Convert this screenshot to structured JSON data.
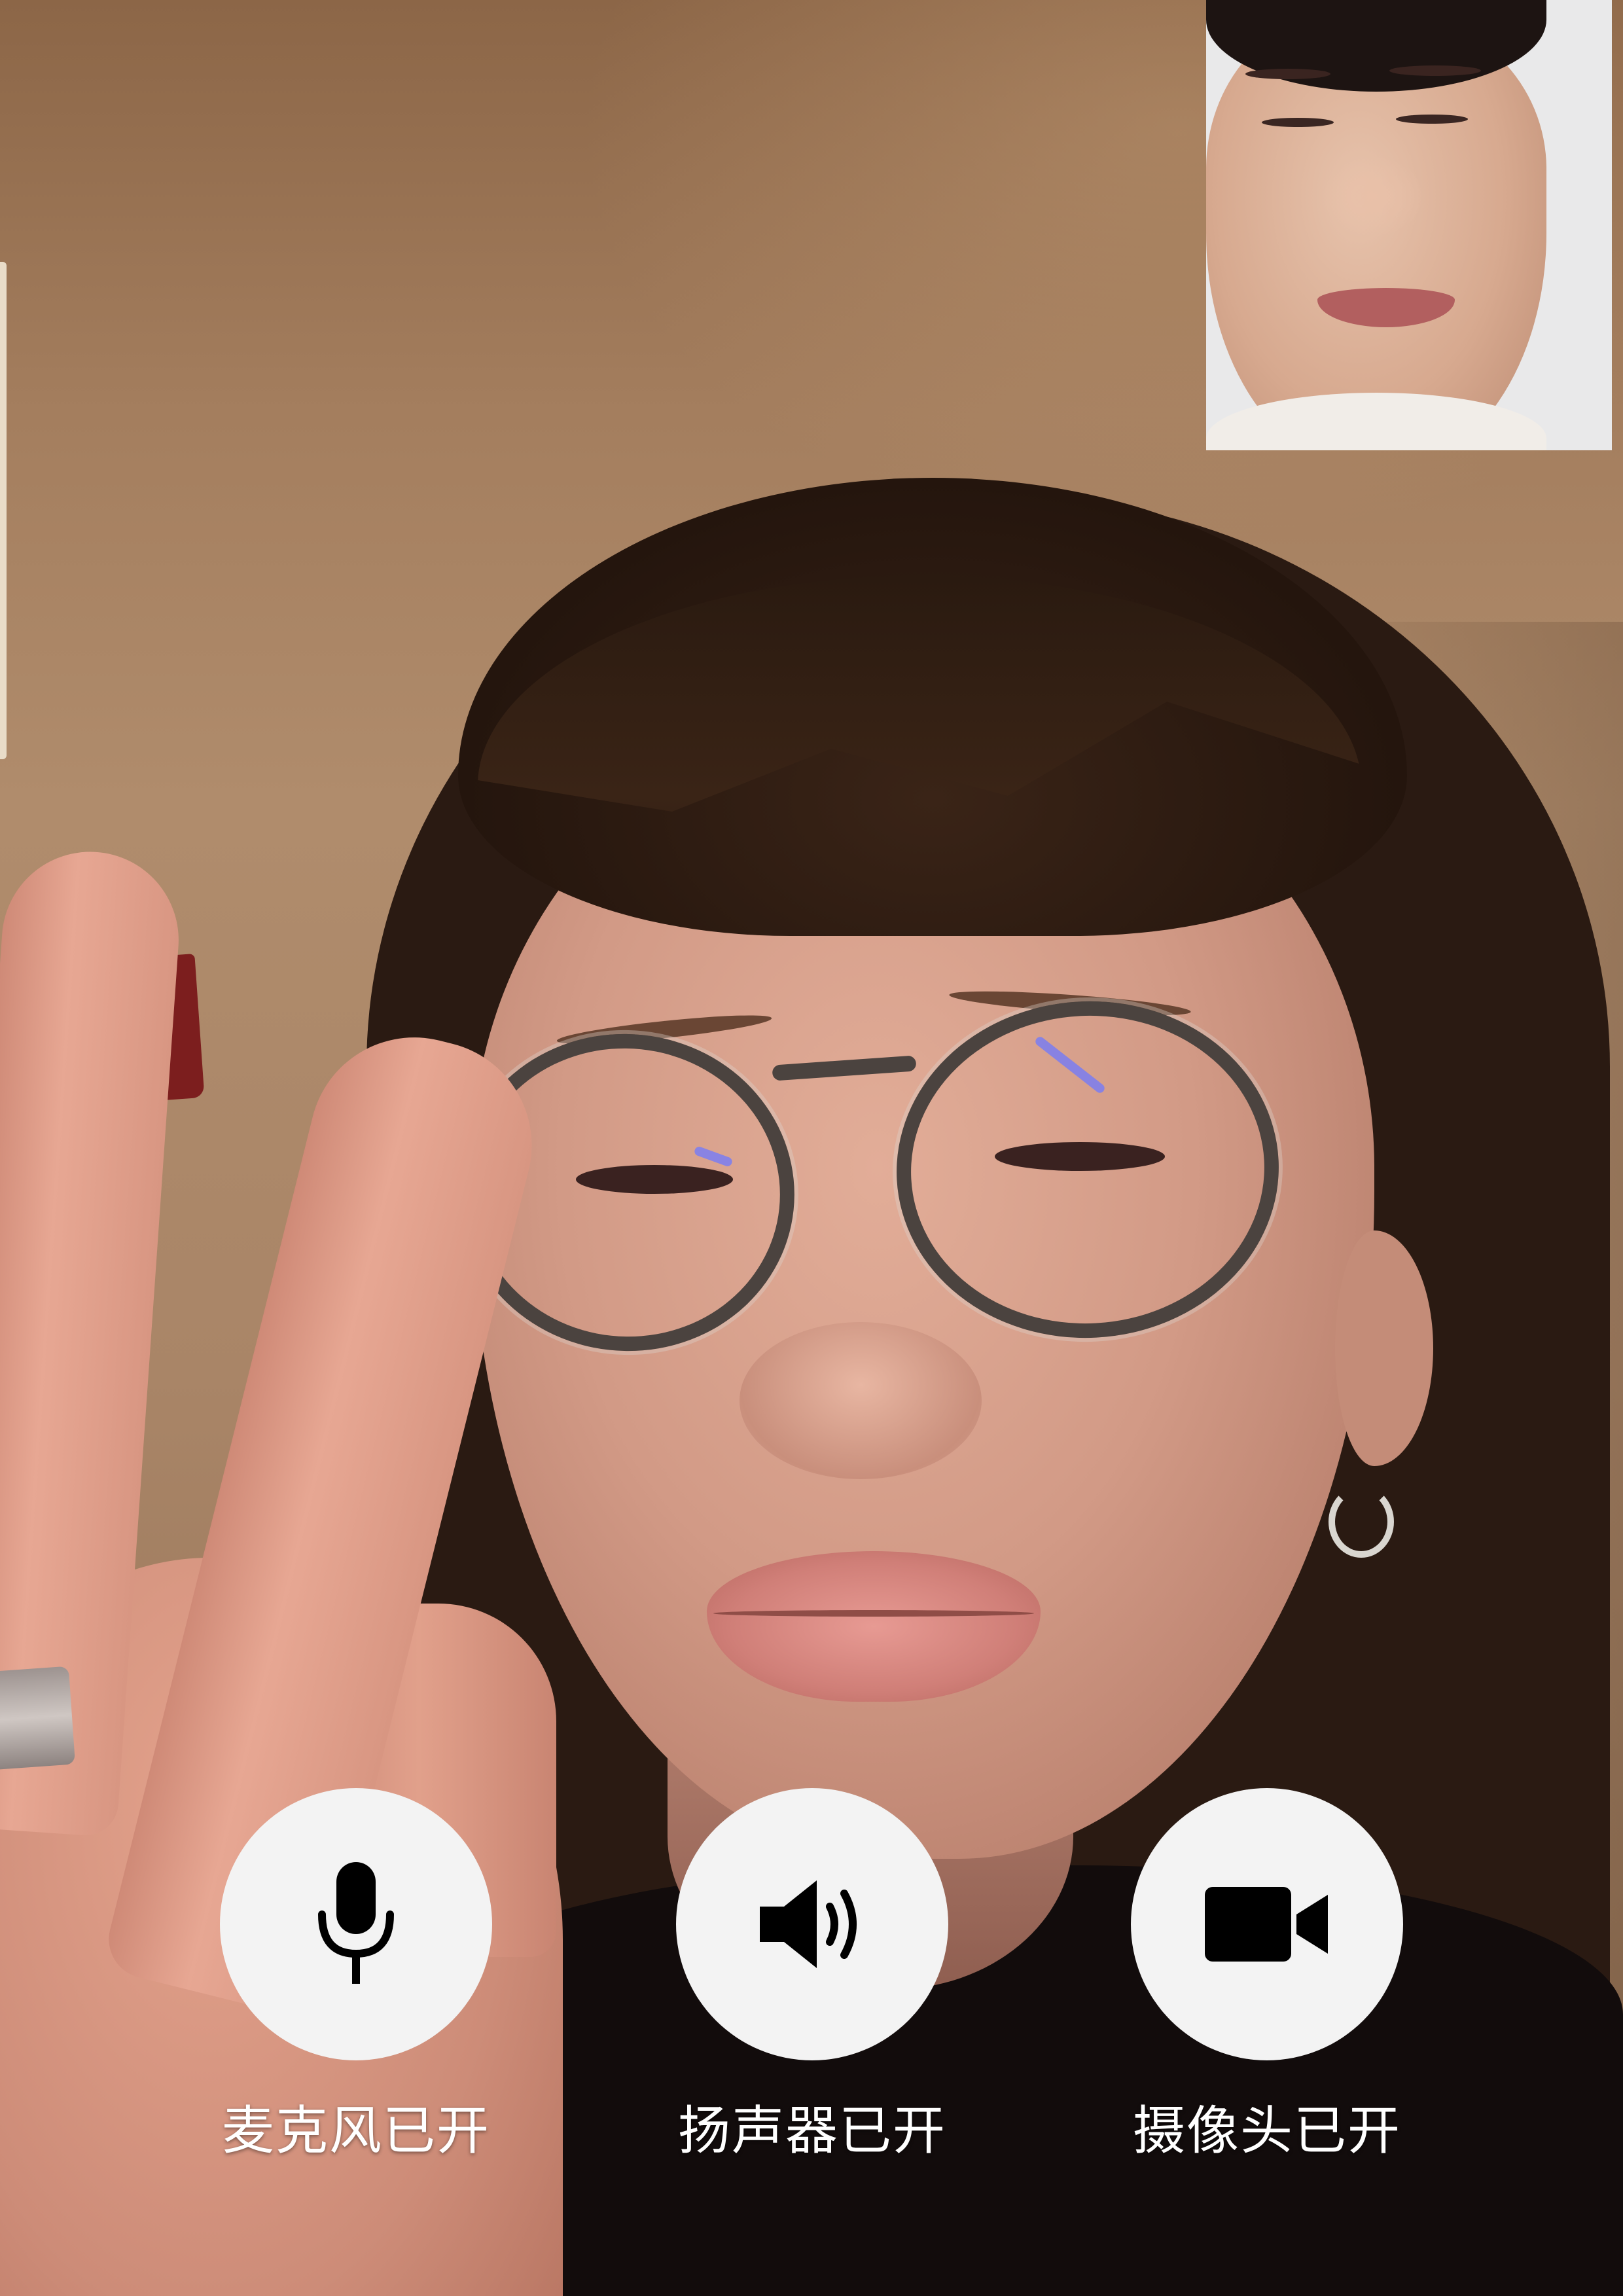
{
  "call": {
    "state": "video-call-active",
    "remote_video": "remote-participant-video",
    "local_video": "self-view-video"
  },
  "controls": [
    {
      "id": "microphone",
      "icon": "microphone-icon",
      "label": "麦克风已开"
    },
    {
      "id": "speaker",
      "icon": "speaker-icon",
      "label": "扬声器已开"
    },
    {
      "id": "camera",
      "icon": "video-camera-icon",
      "label": "摄像头已开"
    }
  ],
  "colors": {
    "button_bg": "#f3f3f3",
    "icon": "#000000",
    "label": "#ffffff"
  }
}
